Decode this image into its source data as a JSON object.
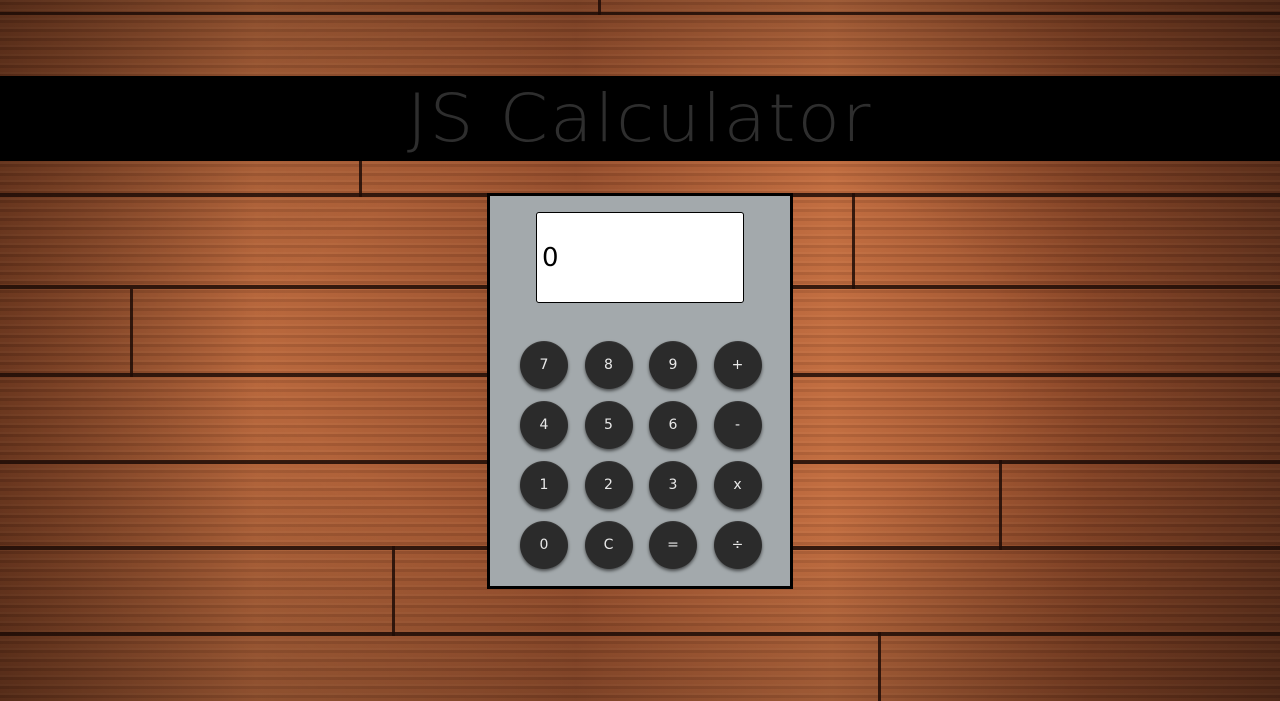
{
  "header": {
    "title": "JS Calculator"
  },
  "calculator": {
    "display_value": "0",
    "keys": [
      {
        "label": "7",
        "name": "key-7-button"
      },
      {
        "label": "8",
        "name": "key-8-button"
      },
      {
        "label": "9",
        "name": "key-9-button"
      },
      {
        "label": "+",
        "name": "add-button"
      },
      {
        "label": "4",
        "name": "key-4-button"
      },
      {
        "label": "5",
        "name": "key-5-button"
      },
      {
        "label": "6",
        "name": "key-6-button"
      },
      {
        "label": "-",
        "name": "subtract-button"
      },
      {
        "label": "1",
        "name": "key-1-button"
      },
      {
        "label": "2",
        "name": "key-2-button"
      },
      {
        "label": "3",
        "name": "key-3-button"
      },
      {
        "label": "x",
        "name": "multiply-button"
      },
      {
        "label": "0",
        "name": "key-0-button"
      },
      {
        "label": "C",
        "name": "clear-button"
      },
      {
        "label": "=",
        "name": "equals-button"
      },
      {
        "label": "÷",
        "name": "divide-button"
      }
    ]
  },
  "colors": {
    "title_bar": "#000000",
    "title_text": "#2e2e2e",
    "calculator_body": "#a3a9ac",
    "key_background": "#2b2b2b",
    "key_text": "#e8e8e8",
    "display_background": "#ffffff"
  }
}
